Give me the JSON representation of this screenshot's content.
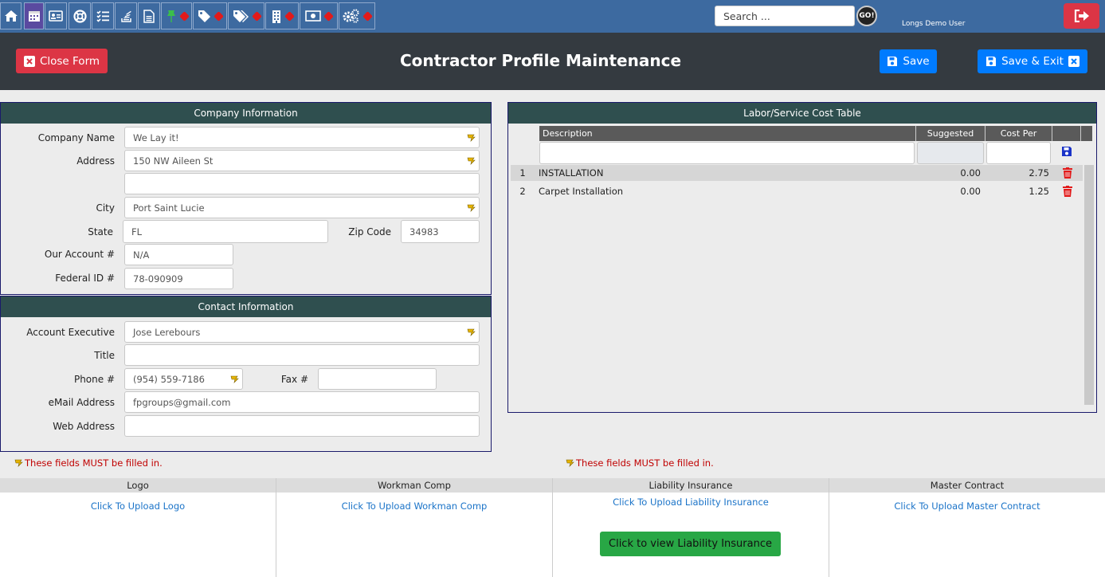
{
  "topbar": {
    "search_placeholder": "Search ...",
    "go_label": "GO!",
    "user_name": "Longs Demo User",
    "icons": [
      "home-icon",
      "calendar-icon",
      "id-card-icon",
      "lifebuoy-icon",
      "checklist-icon",
      "stack-icon",
      "document-icon",
      "pin-icon",
      "tag-icon",
      "tags-icon",
      "building-icon",
      "money-icon",
      "gears-icon"
    ]
  },
  "header": {
    "title": "Contractor Profile Maintenance",
    "close_label": "Close Form",
    "save_label": "Save",
    "save_exit_label": "Save & Exit"
  },
  "company": {
    "title": "Company Information",
    "company_name_label": "Company Name",
    "company_name": "We Lay it!",
    "address_label": "Address",
    "address1": "150 NW Aileen St",
    "address2": "",
    "city_label": "City",
    "city": "Port Saint Lucie",
    "state_label": "State",
    "state": "FL",
    "zip_label": "Zip Code",
    "zip": "34983",
    "account_label": "Our Account #",
    "account": "N/A",
    "federal_label": "Federal ID #",
    "federal": "78-090909"
  },
  "contact": {
    "title": "Contact Information",
    "exec_label": "Account Executive",
    "exec": "Jose Lerebours",
    "title_label": "Title",
    "title_value": "",
    "phone_label": "Phone #",
    "phone": "(954) 559-7186",
    "fax_label": "Fax #",
    "fax": "",
    "email_label": "eMail Address",
    "email": "fpgroups@gmail.com",
    "web_label": "Web Address",
    "web": ""
  },
  "cost_table": {
    "title": "Labor/Service Cost Table",
    "headers": [
      "Description",
      "Suggested",
      "Cost Per"
    ],
    "rows": [
      {
        "num": "1",
        "description": "INSTALLATION",
        "suggested": "0.00",
        "cost": "2.75"
      },
      {
        "num": "2",
        "description": "Carpet Installation",
        "suggested": "0.00",
        "cost": "1.25"
      }
    ]
  },
  "notes": {
    "required_left": "These fields MUST be filled in.",
    "required_right": "These fields MUST be filled in."
  },
  "uploads": {
    "logo_title": "Logo",
    "logo_link": "Click To Upload Logo",
    "comp_title": "Workman Comp",
    "comp_link": "Click To Upload Workman Comp",
    "liability_title": "Liability Insurance",
    "liability_link": "Click To Upload Liability Insurance",
    "liability_view": "Click to view Liability Insurance",
    "master_title": "Master Contract",
    "master_link": "Click To Upload Master Contract"
  }
}
